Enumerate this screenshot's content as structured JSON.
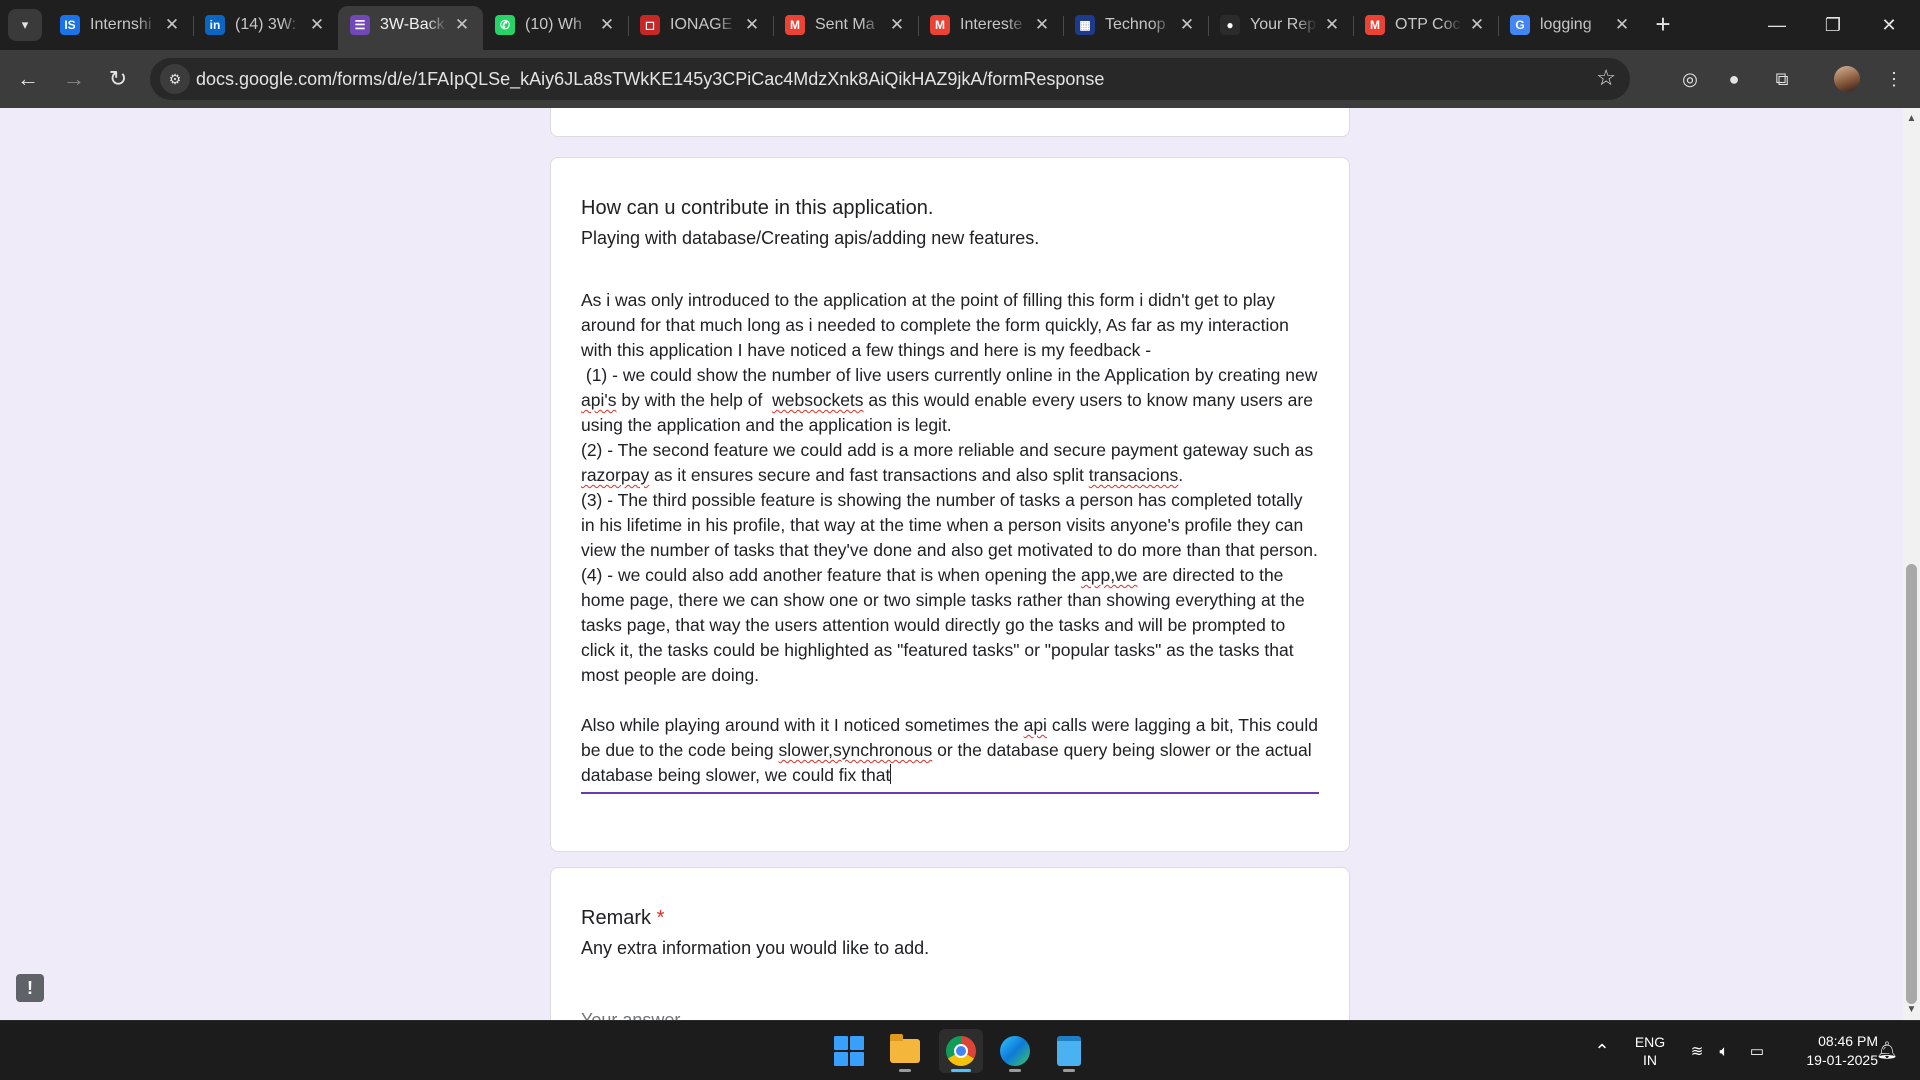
{
  "browser": {
    "tabs": [
      {
        "title": "Internshi",
        "favicon": "internshala-icon",
        "color": "#1a73e8",
        "glyph": "IS"
      },
      {
        "title": "(14) 3W:",
        "favicon": "linkedin-icon",
        "color": "#0a66c2",
        "glyph": "in"
      },
      {
        "title": "3W-Back",
        "favicon": "google-forms-icon",
        "color": "#7248b9",
        "glyph": "☰"
      },
      {
        "title": "(10) Wh",
        "favicon": "whatsapp-icon",
        "color": "#25d366",
        "glyph": "✆"
      },
      {
        "title": "IONAGE",
        "favicon": "ionage-icon",
        "color": "#c62828",
        "glyph": "◻"
      },
      {
        "title": "Sent Ma",
        "favicon": "gmail-icon",
        "color": "#ea4335",
        "glyph": "M"
      },
      {
        "title": "Intereste",
        "favicon": "gmail-icon",
        "color": "#ea4335",
        "glyph": "M"
      },
      {
        "title": "Technop",
        "favicon": "technopedia-icon",
        "color": "#1e3a8a",
        "glyph": "▦"
      },
      {
        "title": "Your Rep",
        "favicon": "github-icon",
        "color": "#2b2b2b",
        "glyph": "●"
      },
      {
        "title": "OTP Coc",
        "favicon": "gmail-icon",
        "color": "#ea4335",
        "glyph": "M"
      },
      {
        "title": "logging",
        "favicon": "google-icon",
        "color": "#4285f4",
        "glyph": "G"
      }
    ],
    "active_tab_index": 2,
    "url": "docs.google.com/forms/d/e/1FAIpQLSe_kAiy6JLa8sTWkKE145y3CPiCac4MdzXnk8AiQikHAZ9jkA/formResponse"
  },
  "form": {
    "question": {
      "title": "How can u contribute in this application.",
      "description": "Playing with database/Creating apis/adding new features.",
      "answer_parts": [
        {
          "t": "As i was only introduced to the application at the point of filling this form i didn't get to play around for that much long as i needed to complete the form quickly, As far as my interaction with this application I have noticed a few things and here is my feedback -\n (1) - we could show the number of live users currently online in the Application by creating new "
        },
        {
          "t": "api's",
          "s": true
        },
        {
          "t": " by with the help of  "
        },
        {
          "t": "websockets",
          "s": true
        },
        {
          "t": " as this would enable every users to know many users are using the application and the application is legit.\n(2) - The second feature we could add is a more reliable and secure payment gateway such as "
        },
        {
          "t": "razorpay",
          "s": true
        },
        {
          "t": " as it ensures secure and fast transactions and also split "
        },
        {
          "t": "transacions",
          "s": true
        },
        {
          "t": ".\n(3) - The third possible feature is showing the number of tasks a person has completed totally in his lifetime in his profile, that way at the time when a person visits anyone's profile they can view the number of tasks that they've done and also get motivated to do more than that person.\n(4) - we could also add another feature that is when opening the "
        },
        {
          "t": "app,we",
          "s": true
        },
        {
          "t": " are directed to the home page, there we can show one or two simple tasks rather than showing everything at the tasks page, that way the users attention would directly go the tasks and will be prompted to click it, the tasks could be highlighted as \"featured tasks\" or \"popular tasks\" as the tasks that most people are doing.\n\nAlso while playing around with it I noticed sometimes the "
        },
        {
          "t": "api",
          "s": true
        },
        {
          "t": " calls were lagging a bit, This could be due to the code being "
        },
        {
          "t": "slower,synchronous",
          "s": true
        },
        {
          "t": " or the database query being slower or the actual database being slower, we could fix that"
        }
      ]
    },
    "remark": {
      "title": "Remark",
      "required_mark": "*",
      "description": "Any extra information you would like to add.",
      "placeholder": "Your answer"
    }
  },
  "taskbar": {
    "language": {
      "line1": "ENG",
      "line2": "IN"
    },
    "time": "08:46 PM",
    "date": "19-01-2025"
  }
}
